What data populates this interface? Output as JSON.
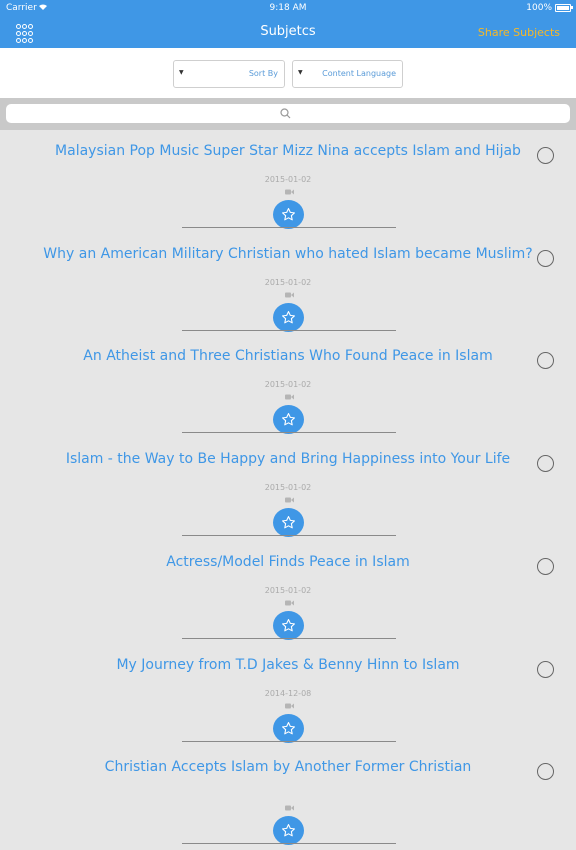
{
  "status": {
    "carrier": "Carrier",
    "time": "9:18 AM",
    "battery": "100%"
  },
  "nav": {
    "title": "Subjetcs",
    "share": "Share Subjects"
  },
  "filters": {
    "sort_by": "Sort By",
    "content_language": "Content Language"
  },
  "search": {
    "icon": "search-icon"
  },
  "items": [
    {
      "title": "Malaysian Pop Music Super Star Mizz Nina accepts Islam and Hijab",
      "date": "2015-01-02"
    },
    {
      "title": "Why an American Military Christian who hated Islam became Muslim?",
      "date": "2015-01-02"
    },
    {
      "title": "An Atheist and Three Christians Who Found Peace in Islam",
      "date": "2015-01-02"
    },
    {
      "title": "Islam - the Way to Be Happy and Bring Happiness into Your Life",
      "date": "2015-01-02"
    },
    {
      "title": "Actress/Model Finds Peace in Islam",
      "date": "2015-01-02"
    },
    {
      "title": "My Journey from T.D Jakes & Benny Hinn to Islam",
      "date": "2014-12-08"
    },
    {
      "title": "Christian Accepts Islam by Another Former Christian",
      "date": ""
    }
  ],
  "colors": {
    "accent": "#3f97e6",
    "share": "#f6b827"
  }
}
